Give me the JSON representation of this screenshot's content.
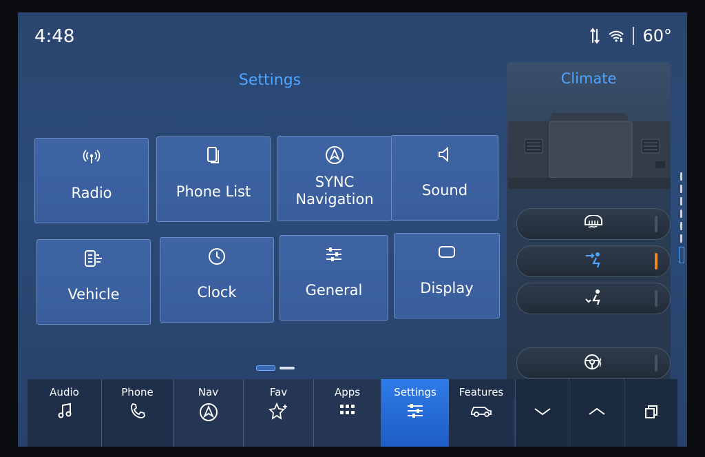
{
  "status": {
    "time": "4:48",
    "temperature": "60°"
  },
  "settings": {
    "title": "Settings",
    "tiles": [
      {
        "label": "Radio",
        "icon": "antenna-icon"
      },
      {
        "label": "Phone List",
        "icon": "phone-list-icon"
      },
      {
        "label": "SYNC\nNavigation",
        "icon": "navigation-icon"
      },
      {
        "label": "Sound",
        "icon": "speaker-icon"
      },
      {
        "label": "Vehicle",
        "icon": "vehicle-settings-icon"
      },
      {
        "label": "Clock",
        "icon": "clock-icon"
      },
      {
        "label": "General",
        "icon": "sliders-icon"
      },
      {
        "label": "Display",
        "icon": "display-icon"
      }
    ],
    "page_indicator": {
      "current": 1,
      "total": 2
    }
  },
  "climate": {
    "title": "Climate",
    "buttons": [
      {
        "icon": "defrost-icon",
        "active": false
      },
      {
        "icon": "airflow-face-icon",
        "active": true
      },
      {
        "icon": "airflow-feet-icon",
        "active": false
      },
      {
        "icon": "heated-steering-wheel-icon",
        "active": false
      }
    ],
    "accent_color": "#f28a1b"
  },
  "bottom_bar": {
    "items": [
      {
        "label": "Audio",
        "icon": "music-note-icon"
      },
      {
        "label": "Phone",
        "icon": "phone-icon"
      },
      {
        "label": "Nav",
        "icon": "navigation-icon"
      },
      {
        "label": "Fav",
        "icon": "star-plus-icon"
      },
      {
        "label": "Apps",
        "icon": "apps-grid-icon"
      },
      {
        "label": "Settings",
        "icon": "sliders-icon",
        "active": true
      },
      {
        "label": "Features",
        "icon": "car-icon"
      }
    ],
    "controls": [
      "chevron-down-icon",
      "chevron-up-icon",
      "windows-icon"
    ]
  },
  "colors": {
    "accent_blue": "#4fa4ff",
    "active_tab": "#2f7be8"
  }
}
